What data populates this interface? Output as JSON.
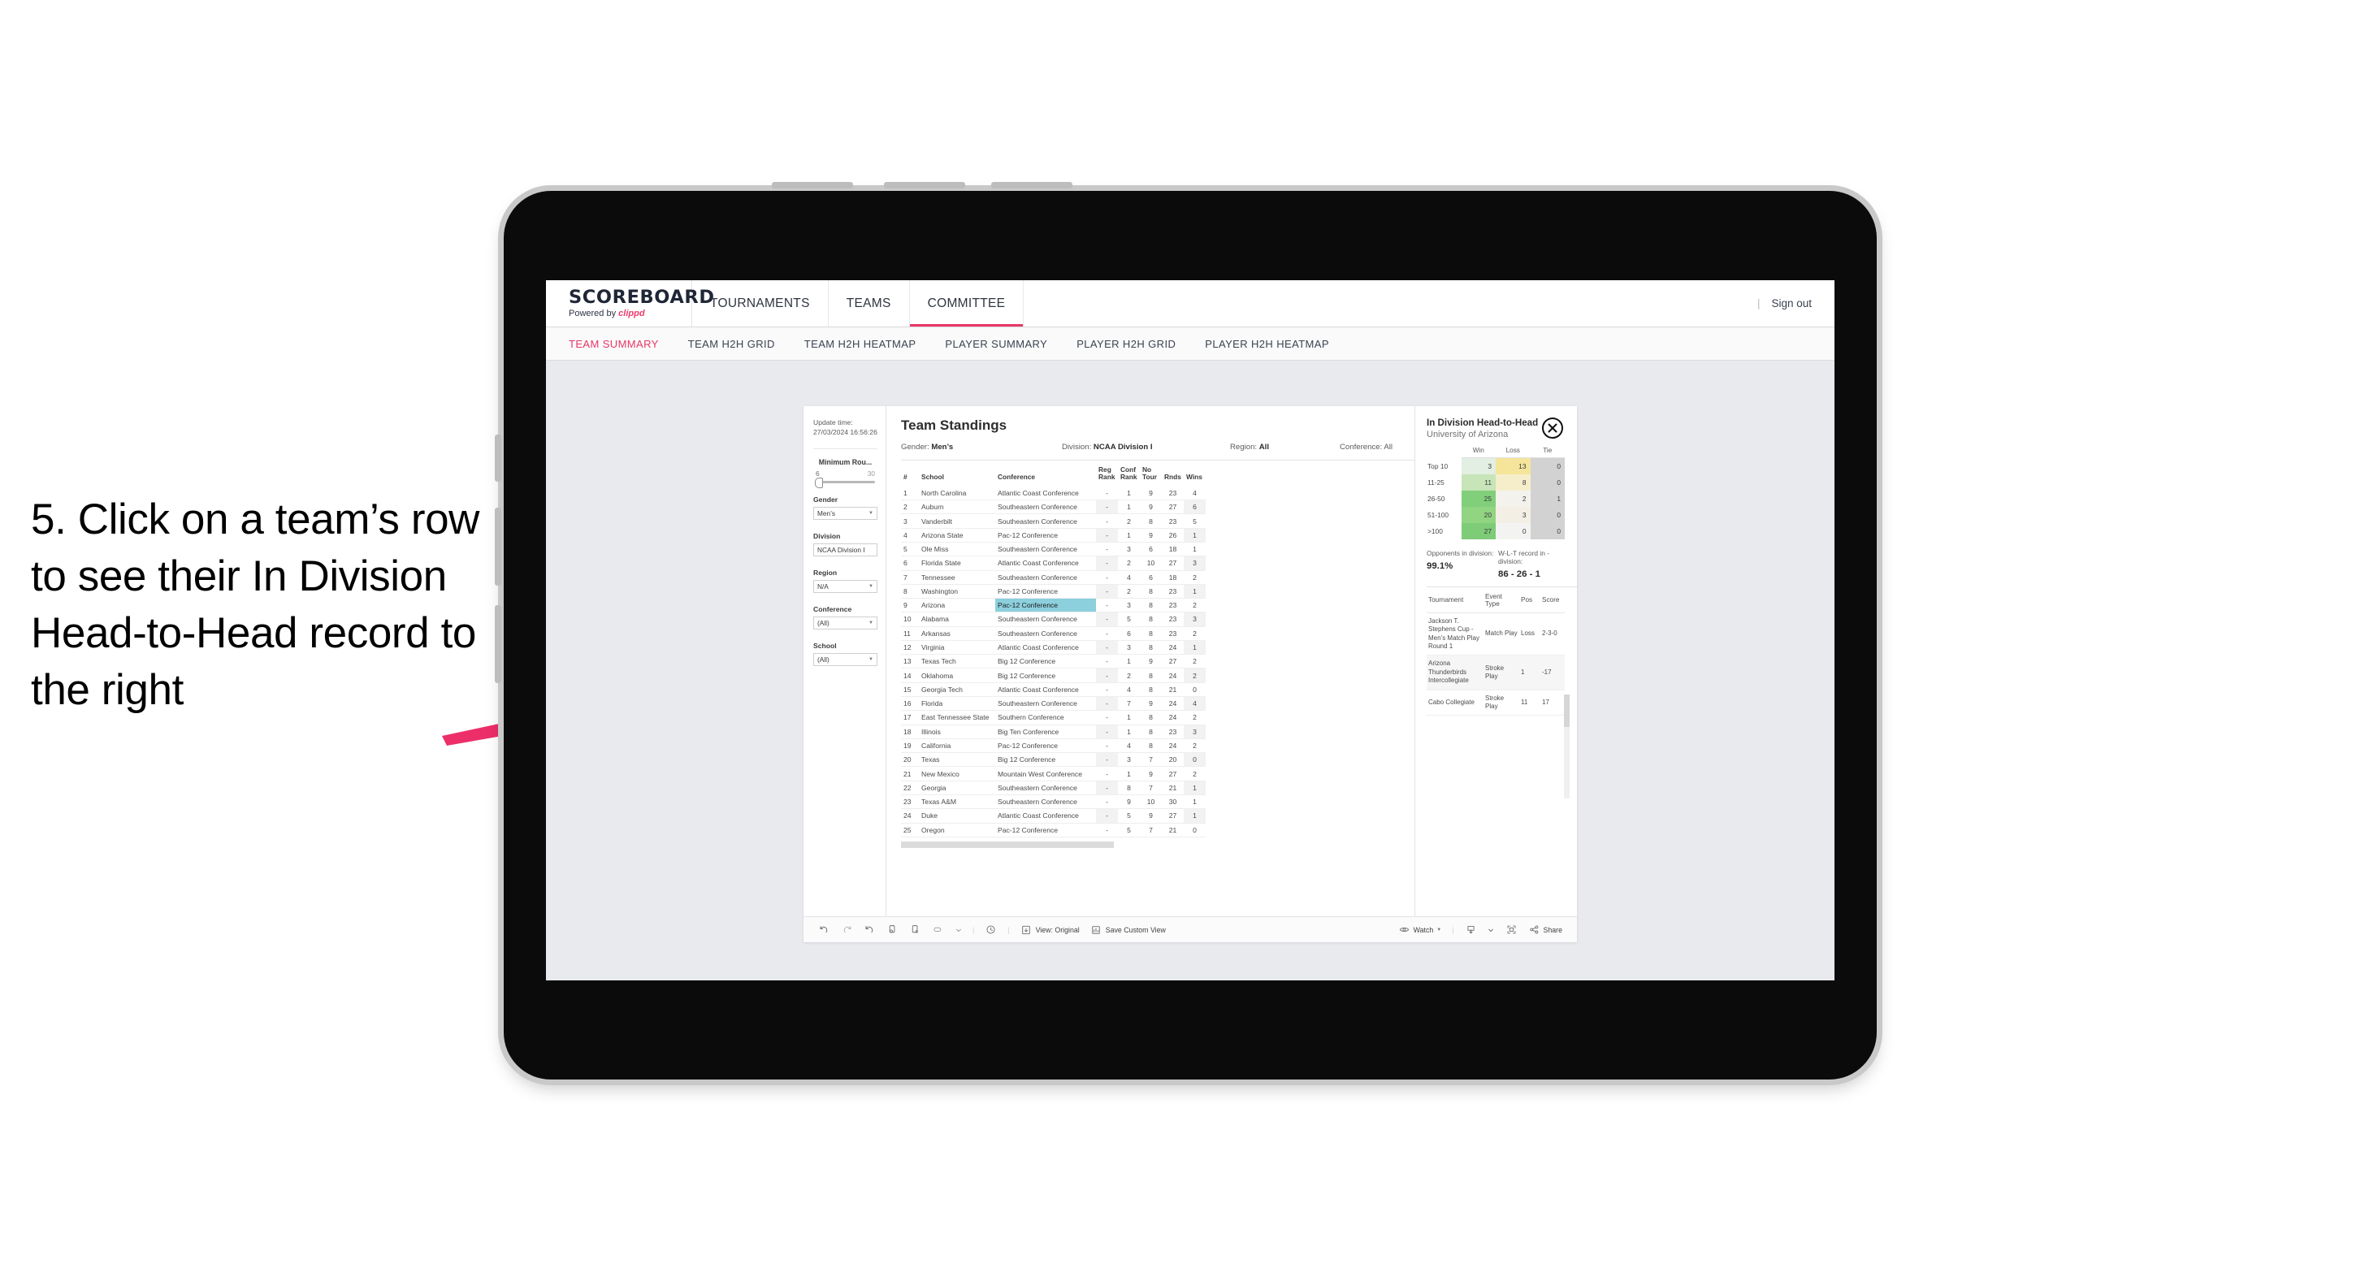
{
  "annotation": {
    "text": "5. Click on a team’s row to see their In Division Head-to-Head record to the right",
    "arrow_color": "#ec2f68"
  },
  "app": {
    "brand": {
      "title": "SCOREBOARD",
      "powered_prefix": "Powered by ",
      "powered_name": "clippd"
    },
    "topnav": [
      {
        "label": "TOURNAMENTS",
        "active": false
      },
      {
        "label": "TEAMS",
        "active": false
      },
      {
        "label": "COMMITTEE",
        "active": true
      }
    ],
    "topbar_right": {
      "divider": "|",
      "sign_out": "Sign out"
    },
    "subnav": [
      {
        "label": "TEAM SUMMARY",
        "active": true
      },
      {
        "label": "TEAM H2H GRID",
        "active": false
      },
      {
        "label": "TEAM H2H HEATMAP",
        "active": false
      },
      {
        "label": "PLAYER SUMMARY",
        "active": false
      },
      {
        "label": "PLAYER H2H GRID",
        "active": false
      },
      {
        "label": "PLAYER H2H HEATMAP",
        "active": false
      }
    ]
  },
  "filters": {
    "update_time_label": "Update time:",
    "update_time_value": "27/03/2024 16:56:26",
    "slider": {
      "title": "Minimum Rou...",
      "min": "6",
      "max": "30"
    },
    "controls": [
      {
        "label": "Gender",
        "value": "Men’s"
      },
      {
        "label": "Division",
        "value": "NCAA Division I"
      },
      {
        "label": "Region",
        "value": "N/A"
      },
      {
        "label": "Conference",
        "value": "(All)"
      },
      {
        "label": "School",
        "value": "(All)"
      }
    ]
  },
  "standings": {
    "title": "Team Standings",
    "meta": [
      {
        "label": "Gender: ",
        "value": "Men’s"
      },
      {
        "label": "Division: ",
        "value": "NCAA Division I"
      },
      {
        "label": "Region: ",
        "value": "All"
      },
      {
        "label": "Conference: ",
        "value": "All"
      }
    ],
    "columns": [
      "#",
      "School",
      "Conference",
      "Reg Rank",
      "Conf Rank",
      "No Tour",
      "Rnds",
      "Wins"
    ],
    "rows": [
      {
        "n": "1",
        "school": "North Carolina",
        "conf": "Atlantic Coast Conference",
        "reg": "-",
        "cr": "1",
        "nt": "9",
        "rnds": "23",
        "wins": "4"
      },
      {
        "n": "2",
        "school": "Auburn",
        "conf": "Southeastern Conference",
        "reg": "-",
        "cr": "1",
        "nt": "9",
        "rnds": "27",
        "wins": "6"
      },
      {
        "n": "3",
        "school": "Vanderbilt",
        "conf": "Southeastern Conference",
        "reg": "-",
        "cr": "2",
        "nt": "8",
        "rnds": "23",
        "wins": "5"
      },
      {
        "n": "4",
        "school": "Arizona State",
        "conf": "Pac-12 Conference",
        "reg": "-",
        "cr": "1",
        "nt": "9",
        "rnds": "26",
        "wins": "1"
      },
      {
        "n": "5",
        "school": "Ole Miss",
        "conf": "Southeastern Conference",
        "reg": "-",
        "cr": "3",
        "nt": "6",
        "rnds": "18",
        "wins": "1"
      },
      {
        "n": "6",
        "school": "Florida State",
        "conf": "Atlantic Coast Conference",
        "reg": "-",
        "cr": "2",
        "nt": "10",
        "rnds": "27",
        "wins": "3"
      },
      {
        "n": "7",
        "school": "Tennessee",
        "conf": "Southeastern Conference",
        "reg": "-",
        "cr": "4",
        "nt": "6",
        "rnds": "18",
        "wins": "2"
      },
      {
        "n": "8",
        "school": "Washington",
        "conf": "Pac-12 Conference",
        "reg": "-",
        "cr": "2",
        "nt": "8",
        "rnds": "23",
        "wins": "1"
      },
      {
        "n": "9",
        "school": "Arizona",
        "conf": "Pac-12 Conference",
        "reg": "-",
        "cr": "3",
        "nt": "8",
        "rnds": "23",
        "wins": "2",
        "selected": true
      },
      {
        "n": "10",
        "school": "Alabama",
        "conf": "Southeastern Conference",
        "reg": "-",
        "cr": "5",
        "nt": "8",
        "rnds": "23",
        "wins": "3"
      },
      {
        "n": "11",
        "school": "Arkansas",
        "conf": "Southeastern Conference",
        "reg": "-",
        "cr": "6",
        "nt": "8",
        "rnds": "23",
        "wins": "2"
      },
      {
        "n": "12",
        "school": "Virginia",
        "conf": "Atlantic Coast Conference",
        "reg": "-",
        "cr": "3",
        "nt": "8",
        "rnds": "24",
        "wins": "1"
      },
      {
        "n": "13",
        "school": "Texas Tech",
        "conf": "Big 12 Conference",
        "reg": "-",
        "cr": "1",
        "nt": "9",
        "rnds": "27",
        "wins": "2"
      },
      {
        "n": "14",
        "school": "Oklahoma",
        "conf": "Big 12 Conference",
        "reg": "-",
        "cr": "2",
        "nt": "8",
        "rnds": "24",
        "wins": "2"
      },
      {
        "n": "15",
        "school": "Georgia Tech",
        "conf": "Atlantic Coast Conference",
        "reg": "-",
        "cr": "4",
        "nt": "8",
        "rnds": "21",
        "wins": "0"
      },
      {
        "n": "16",
        "school": "Florida",
        "conf": "Southeastern Conference",
        "reg": "-",
        "cr": "7",
        "nt": "9",
        "rnds": "24",
        "wins": "4"
      },
      {
        "n": "17",
        "school": "East Tennessee State",
        "conf": "Southern Conference",
        "reg": "-",
        "cr": "1",
        "nt": "8",
        "rnds": "24",
        "wins": "2"
      },
      {
        "n": "18",
        "school": "Illinois",
        "conf": "Big Ten Conference",
        "reg": "-",
        "cr": "1",
        "nt": "8",
        "rnds": "23",
        "wins": "3"
      },
      {
        "n": "19",
        "school": "California",
        "conf": "Pac-12 Conference",
        "reg": "-",
        "cr": "4",
        "nt": "8",
        "rnds": "24",
        "wins": "2"
      },
      {
        "n": "20",
        "school": "Texas",
        "conf": "Big 12 Conference",
        "reg": "-",
        "cr": "3",
        "nt": "7",
        "rnds": "20",
        "wins": "0"
      },
      {
        "n": "21",
        "school": "New Mexico",
        "conf": "Mountain West Conference",
        "reg": "-",
        "cr": "1",
        "nt": "9",
        "rnds": "27",
        "wins": "2"
      },
      {
        "n": "22",
        "school": "Georgia",
        "conf": "Southeastern Conference",
        "reg": "-",
        "cr": "8",
        "nt": "7",
        "rnds": "21",
        "wins": "1"
      },
      {
        "n": "23",
        "school": "Texas A&M",
        "conf": "Southeastern Conference",
        "reg": "-",
        "cr": "9",
        "nt": "10",
        "rnds": "30",
        "wins": "1"
      },
      {
        "n": "24",
        "school": "Duke",
        "conf": "Atlantic Coast Conference",
        "reg": "-",
        "cr": "5",
        "nt": "9",
        "rnds": "27",
        "wins": "1"
      },
      {
        "n": "25",
        "school": "Oregon",
        "conf": "Pac-12 Conference",
        "reg": "-",
        "cr": "5",
        "nt": "7",
        "rnds": "21",
        "wins": "0"
      }
    ]
  },
  "h2h": {
    "title": "In Division Head-to-Head",
    "subtitle": "University of Arizona",
    "close_icon": "close-icon",
    "columns": [
      "",
      "Win",
      "Loss",
      "Tie"
    ],
    "rows": [
      {
        "label": "Top 10",
        "win": "3",
        "loss": "13",
        "tie": "0",
        "win_color": "#e2efe2",
        "loss_color": "#f4e59b",
        "tie_color": "#d2d2d2"
      },
      {
        "label": "11-25",
        "win": "11",
        "loss": "8",
        "tie": "0",
        "win_color": "#c7e5b9",
        "loss_color": "#f6eecb",
        "tie_color": "#d2d2d2"
      },
      {
        "label": "26-50",
        "win": "25",
        "loss": "2",
        "tie": "1",
        "win_color": "#81ce7b",
        "loss_color": "#f3f2ec",
        "tie_color": "#d2d2d2"
      },
      {
        "label": "51-100",
        "win": "20",
        "loss": "3",
        "tie": "0",
        "win_color": "#91d482",
        "loss_color": "#f4efe4",
        "tie_color": "#d2d2d2"
      },
      {
        "label": ">100",
        "win": "27",
        "loss": "0",
        "tie": "0",
        "win_color": "#7ecb78",
        "loss_color": "#f3f3f1",
        "tie_color": "#d2d2d2"
      }
    ],
    "stats": [
      {
        "label": "Opponents in division:",
        "value": "99.1%"
      },
      {
        "label": "W-L-T record in -division:",
        "value": "86 - 26 - 1"
      }
    ],
    "tournaments": {
      "columns": [
        "Tournament",
        "Event Type",
        "Pos",
        "Score"
      ],
      "rows": [
        {
          "name": "Jackson T. Stephens Cup - Men’s Match Play Round 1",
          "type": "Match Play",
          "pos": "Loss",
          "score": "2-3-0"
        },
        {
          "name": "Arizona Thunderbirds Intercollegiate",
          "type": "Stroke Play",
          "pos": "1",
          "score": "-17"
        },
        {
          "name": "Cabo Collegiate",
          "type": "Stroke Play",
          "pos": "11",
          "score": "17"
        }
      ]
    }
  },
  "toolbar": {
    "icons": [
      "undo-icon",
      "redo-icon",
      "revert-icon",
      "refresh-data-icon",
      "pause-updates-icon",
      "new-worksheet-icon",
      "chevron-down-icon",
      "clock-history-icon"
    ],
    "view_label": "View: Original",
    "save_label": "Save Custom View",
    "watch_label": "Watch",
    "share_label": "Share"
  }
}
